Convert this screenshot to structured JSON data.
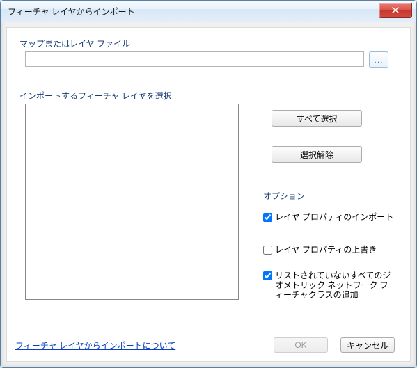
{
  "title": "フィーチャ レイヤからインポート",
  "labels": {
    "map_or_layer_file": "マップまたはレイヤ ファイル",
    "select_layers": "インポートするフィーチャ レイヤを選択",
    "options": "オプション"
  },
  "path_input": {
    "value": "",
    "placeholder": ""
  },
  "browse_button": {
    "label": "..."
  },
  "buttons": {
    "select_all": "すべて選択",
    "clear_selection": "選択解除",
    "ok": "OK",
    "cancel": "キャンセル"
  },
  "options": {
    "import_layer_properties": {
      "label": "レイヤ プロパティのインポート",
      "checked": true
    },
    "overwrite_layer_properties": {
      "label": "レイヤ プロパティの上書き",
      "checked": false
    },
    "add_unlisted_geometric_network": {
      "label": "リストされていないすべてのジオメトリック ネットワーク フィーチャクラスの追加",
      "checked": true
    }
  },
  "help_link": "フィーチャ レイヤからインポートについて",
  "icons": {
    "close": "close-icon",
    "browse": "ellipsis-icon"
  },
  "colors": {
    "group_label": "#1a3e74",
    "link": "#0a3fc0"
  }
}
